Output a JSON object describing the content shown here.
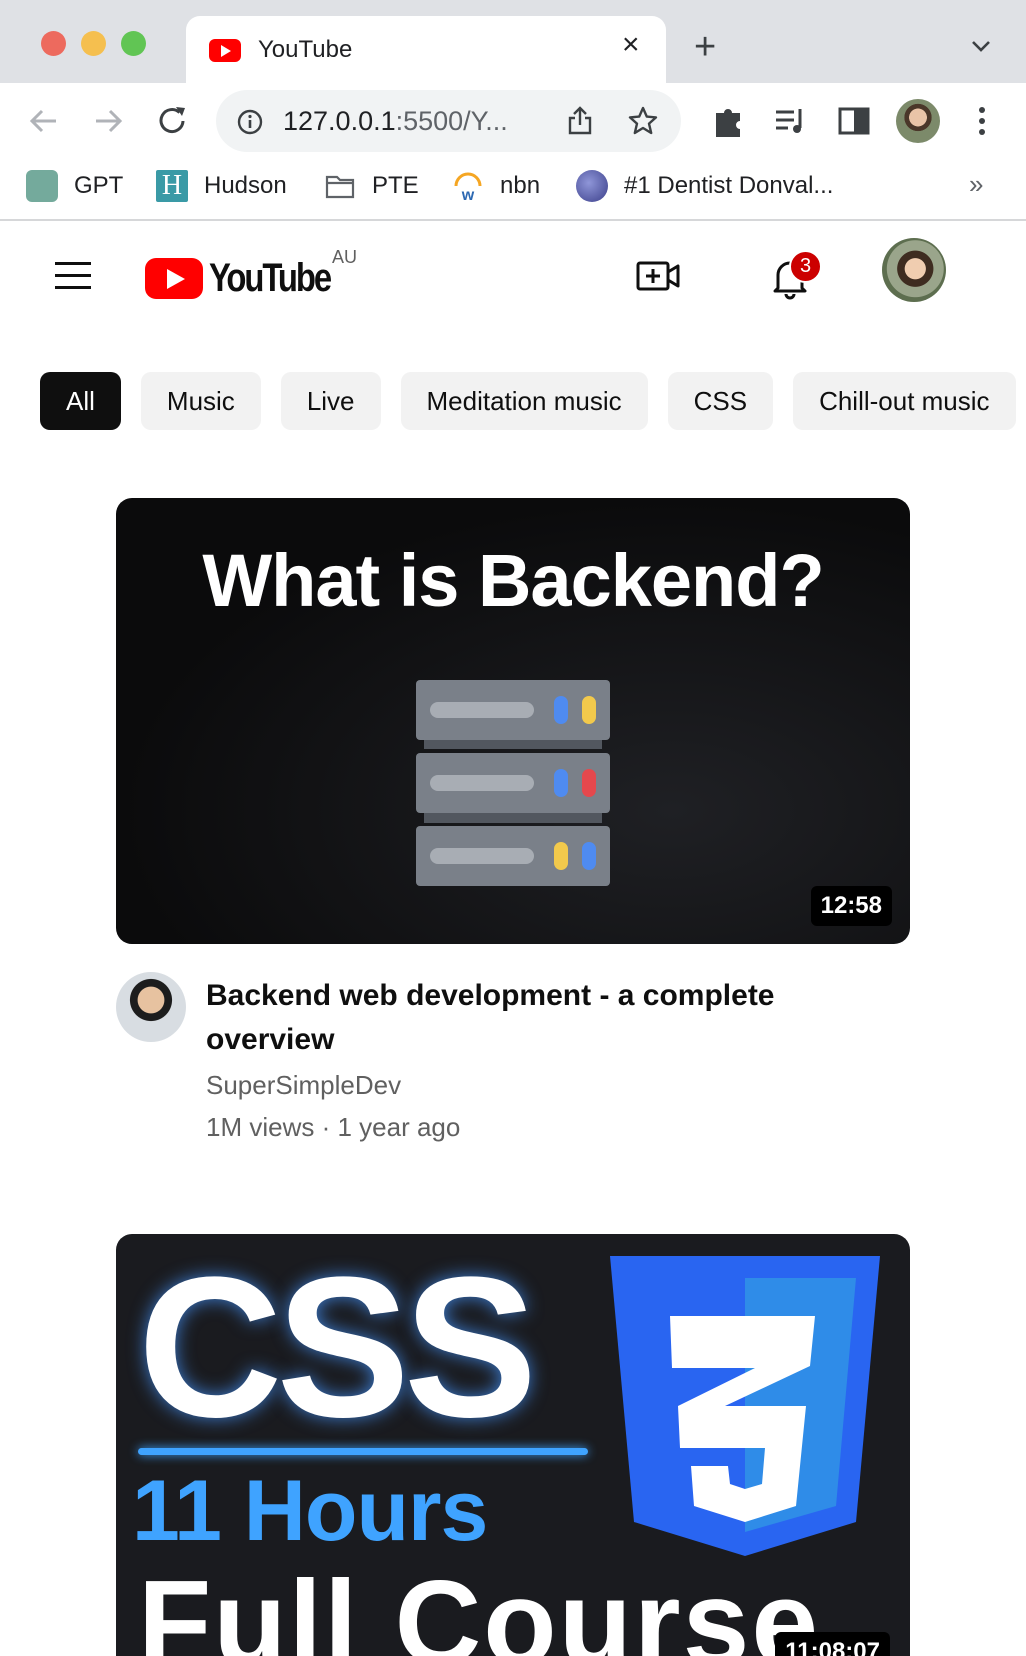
{
  "browser": {
    "tab_title": "YouTube",
    "url_host": "127.0.0.1",
    "url_rest": ":5500/Y...",
    "bookmarks": [
      {
        "label": "GPT",
        "icon": "chatgpt-icon"
      },
      {
        "label": "Hudson",
        "icon": "hudson-icon"
      },
      {
        "label": "PTE",
        "icon": "folder-icon"
      },
      {
        "label": "nbn",
        "icon": "nbn-icon"
      },
      {
        "label": "#1 Dentist Donval...",
        "icon": "dentist-icon"
      }
    ],
    "more_bookmarks": "»"
  },
  "header": {
    "logo_text": "YouTube",
    "country_code": "AU",
    "notification_count": "3"
  },
  "chips": [
    "All",
    "Music",
    "Live",
    "Meditation music",
    "CSS",
    "Chill-out music"
  ],
  "videos": [
    {
      "thumb_text": "What is Backend?",
      "duration": "12:58",
      "title": "Backend web development - a complete overview",
      "channel": "SuperSimpleDev",
      "meta": "1M views · 1 year ago"
    },
    {
      "thumb_text_1": "CSS",
      "thumb_text_2": "11 Hours",
      "thumb_text_3": "Full Course",
      "duration": "11:08:07"
    }
  ],
  "colors": {
    "youtube_red": "#ff0000",
    "chip_active_bg": "#0f0f0f",
    "chip_bg": "#f2f2f2",
    "meta_gray": "#606060",
    "css_blue": "#3fa3ff"
  }
}
